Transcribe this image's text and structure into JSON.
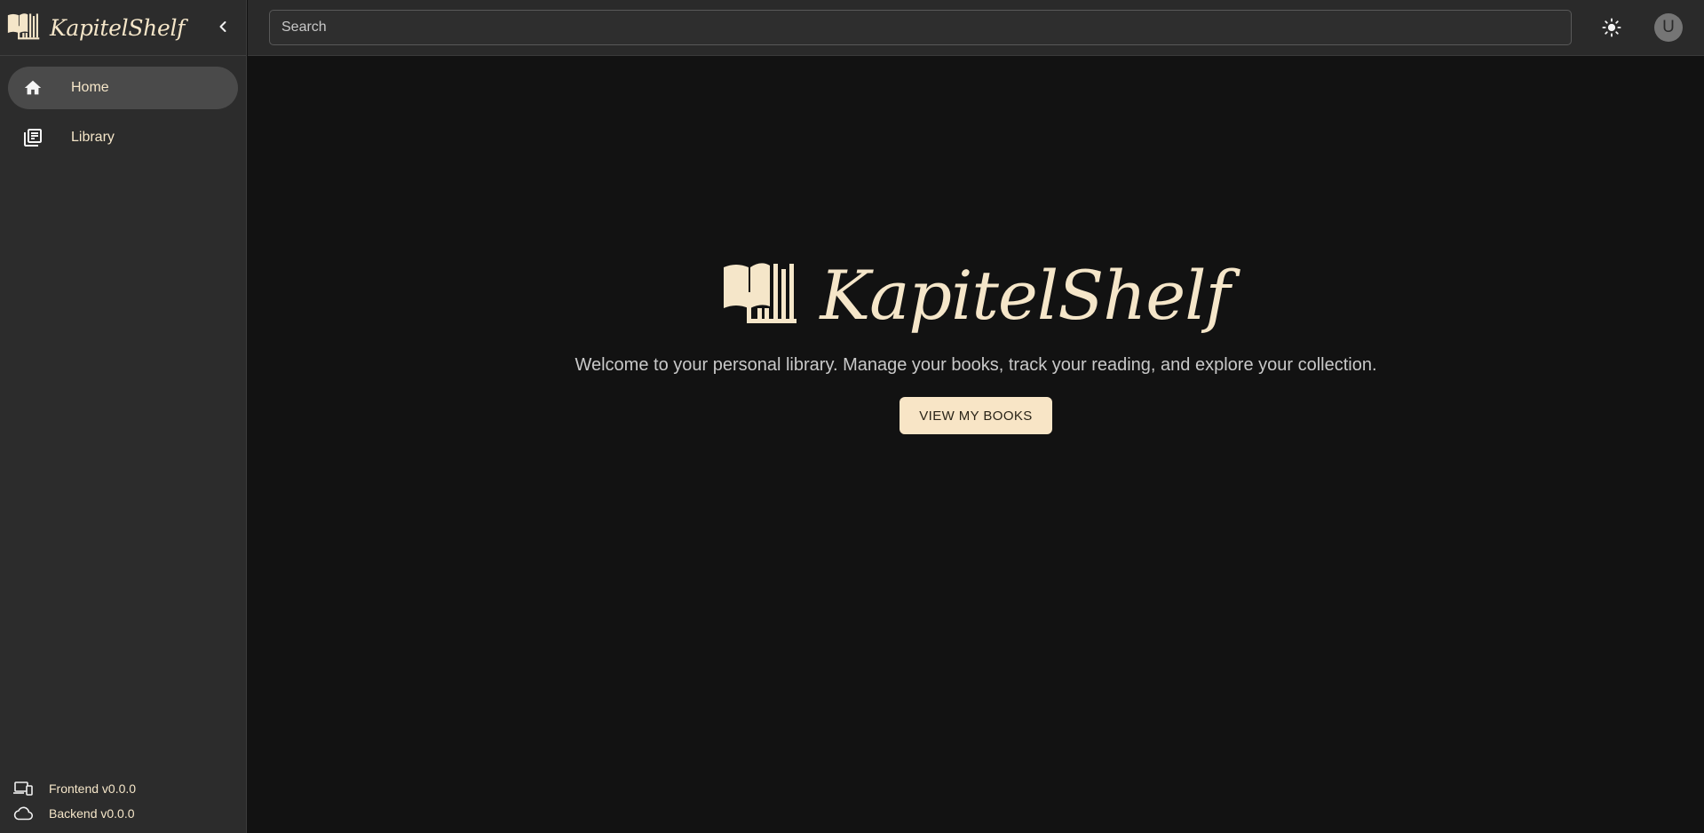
{
  "app": {
    "name": "KapitelShelf",
    "accent_color": "#f5e6c9"
  },
  "sidebar": {
    "collapse_icon": "chevron-left-icon",
    "items": [
      {
        "label": "Home",
        "icon": "home-icon",
        "active": true
      },
      {
        "label": "Library",
        "icon": "library-icon",
        "active": false
      }
    ],
    "versions": [
      {
        "label": "Frontend v0.0.0",
        "icon": "devices-icon"
      },
      {
        "label": "Backend v0.0.0",
        "icon": "cloud-icon"
      }
    ]
  },
  "topbar": {
    "search_placeholder": "Search",
    "theme_icon": "sun-icon",
    "avatar_initial": "U"
  },
  "hero": {
    "title": "KapitelShelf",
    "subtitle": "Welcome to your personal library. Manage your books, track your reading, and explore your collection.",
    "button_label": "VIEW MY BOOKS"
  }
}
